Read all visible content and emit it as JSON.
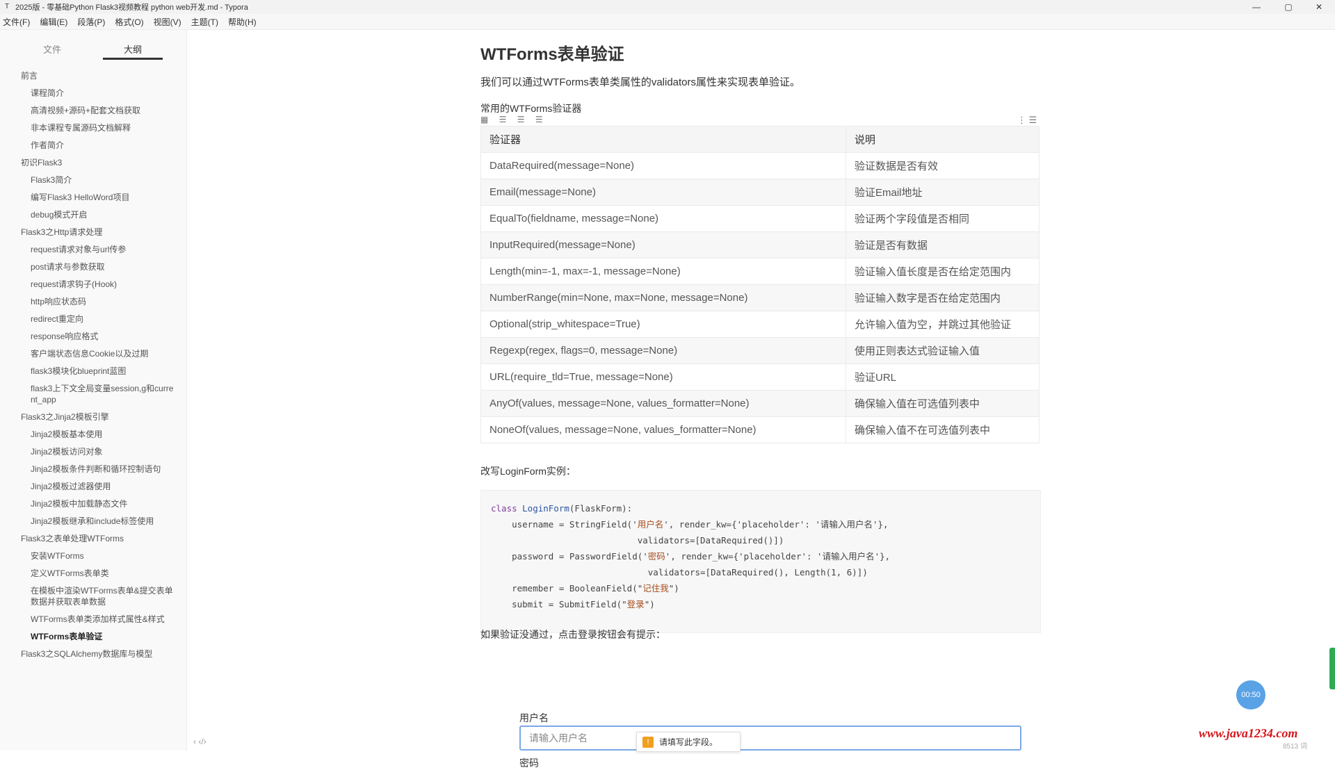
{
  "window": {
    "title": "2025版 - 零基础Python Flask3视频教程 python web开发.md - Typora",
    "minimize": "—",
    "maximize": "▢",
    "close": "✕"
  },
  "menubar": [
    "文件(F)",
    "编辑(E)",
    "段落(P)",
    "格式(O)",
    "视图(V)",
    "主题(T)",
    "帮助(H)"
  ],
  "sidebar": {
    "tab_files": "文件",
    "tab_outline": "大纲",
    "outline": [
      {
        "label": "前言",
        "level": 1
      },
      {
        "label": "课程简介",
        "level": 2
      },
      {
        "label": "高清视频+源码+配套文档获取",
        "level": 2
      },
      {
        "label": "非本课程专属源码文档解释",
        "level": 2
      },
      {
        "label": "作者简介",
        "level": 2
      },
      {
        "label": "初识Flask3",
        "level": 1
      },
      {
        "label": "Flask3简介",
        "level": 2
      },
      {
        "label": "编写Flask3 HelloWord项目",
        "level": 2
      },
      {
        "label": "debug模式开启",
        "level": 2
      },
      {
        "label": "Flask3之Http请求处理",
        "level": 1
      },
      {
        "label": "request请求对象与url传参",
        "level": 2
      },
      {
        "label": "post请求与参数获取",
        "level": 2
      },
      {
        "label": "request请求钩子(Hook)",
        "level": 2
      },
      {
        "label": "http响应状态码",
        "level": 2
      },
      {
        "label": "redirect重定向",
        "level": 2
      },
      {
        "label": "response响应格式",
        "level": 2
      },
      {
        "label": "客户端状态信息Cookie以及过期",
        "level": 2
      },
      {
        "label": "flask3模块化blueprint蓝图",
        "level": 2
      },
      {
        "label": "flask3上下文全局变量session,g和current_app",
        "level": 2
      },
      {
        "label": "Flask3之Jinja2模板引擎",
        "level": 1
      },
      {
        "label": "Jinja2模板基本使用",
        "level": 2
      },
      {
        "label": "Jinja2模板访问对象",
        "level": 2
      },
      {
        "label": "Jinja2模板条件判断和循环控制语句",
        "level": 2
      },
      {
        "label": "Jinja2模板过滤器使用",
        "level": 2
      },
      {
        "label": "Jinja2模板中加载静态文件",
        "level": 2
      },
      {
        "label": "Jinja2模板继承和include标签使用",
        "level": 2
      },
      {
        "label": "Flask3之表单处理WTForms",
        "level": 1
      },
      {
        "label": "安装WTForms",
        "level": 2
      },
      {
        "label": "定义WTForms表单类",
        "level": 2
      },
      {
        "label": "在模板中渲染WTForms表单&提交表单数据并获取表单数据",
        "level": 2
      },
      {
        "label": "WTForms表单类添加样式属性&样式",
        "level": 2
      },
      {
        "label": "WTForms表单验证",
        "level": 2,
        "active": true
      },
      {
        "label": "Flask3之SQLAlchemy数据库与模型",
        "level": 1
      }
    ],
    "bottom_icons": "‹  ‹/›"
  },
  "content": {
    "heading": "WTForms表单验证",
    "intro": "我们可以通过WTForms表单类属性的validators属性来实现表单验证。",
    "table_caption": "常用的WTForms验证器",
    "table_tools": "▦ ☰ ☰ ☰",
    "table_menu": "⋮ ☰",
    "table_headers": [
      "验证器",
      "说明"
    ],
    "table_rows": [
      [
        "DataRequired(message=None)",
        "验证数据是否有效"
      ],
      [
        "Email(message=None)",
        "验证Email地址"
      ],
      [
        "EqualTo(fieldname, message=None)",
        "验证两个字段值是否相同"
      ],
      [
        "InputRequired(message=None)",
        "验证是否有数据"
      ],
      [
        "Length(min=-1, max=-1, message=None)",
        "验证输入值长度是否在给定范围内"
      ],
      [
        "NumberRange(min=None, max=None, message=None)",
        "验证输入数字是否在给定范围内"
      ],
      [
        "Optional(strip_whitespace=True)",
        "允许输入值为空，并跳过其他验证"
      ],
      [
        "Regexp(regex, flags=0, message=None)",
        "使用正则表达式验证输入值"
      ],
      [
        "URL(require_tld=True, message=None)",
        "验证URL"
      ],
      [
        "AnyOf(values, message=None, values_formatter=None)",
        "确保输入值在可选值列表中"
      ],
      [
        "NoneOf(values, message=None, values_formatter=None)",
        "确保输入值不在可选值列表中"
      ]
    ],
    "example_intro": "改写LoginForm实例：",
    "code_lines": [
      {
        "kw": "class ",
        "cls": "LoginForm",
        "rest": "(FlaskForm):"
      },
      {
        "text": "    username = StringField('",
        "str": "用户名",
        "rest": "', render_kw={'placeholder': '请输入用户名'},"
      },
      {
        "text": "                            validators=[DataRequired()])"
      },
      {
        "text": "    password = PasswordField('",
        "str": "密码",
        "rest": "', render_kw={'placeholder': '请输入用户名'},"
      },
      {
        "text": "                              validators=[DataRequired(), Length(1, 6)])"
      },
      {
        "text": "    remember = BooleanField(\"",
        "str": "记住我",
        "rest": "\")"
      },
      {
        "text": "    submit = SubmitField(\"",
        "str": "登录",
        "rest": "\")"
      }
    ],
    "after_code": "如果验证没通过，点击登录按钮会有提示：",
    "form_username_label": "用户名",
    "form_username_placeholder": "请输入用户名",
    "form_password_label": "密码"
  },
  "overlay": {
    "popup_text": "请填写此字段。",
    "popup_icon": "!",
    "timer": "00:50",
    "watermark": "www.java1234.com",
    "wordcount": "8513 词"
  },
  "colors": {
    "accent": "#5aa2e6",
    "watermark": "#d6161d",
    "input_border": "#7aa8e8"
  }
}
